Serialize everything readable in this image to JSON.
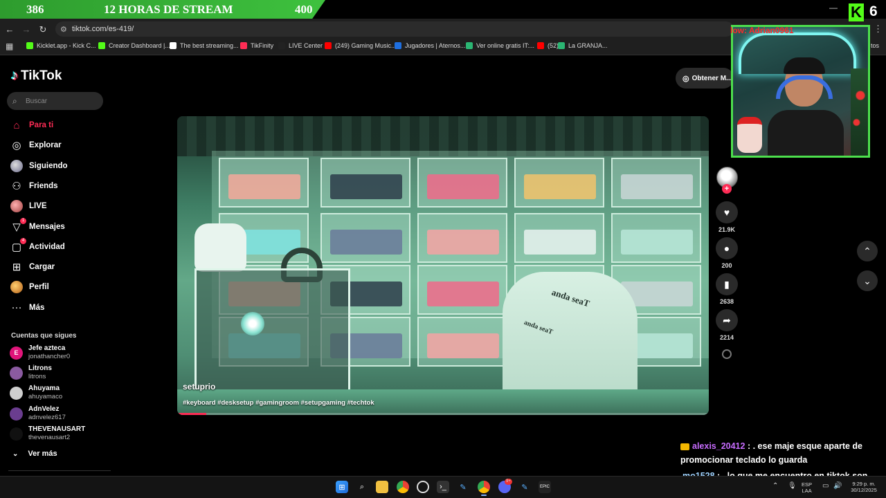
{
  "banner": {
    "left_number": "386",
    "title": "12 HORAS DE STREAM",
    "right_number": "400"
  },
  "browser": {
    "url": "tiktok.com/es-419/",
    "bookmarks": [
      {
        "label": "Kicklet.app - Kick C...",
        "color": "#53fc18"
      },
      {
        "label": "Creator Dashboard |...",
        "color": "#53fc18"
      },
      {
        "label": "The best streaming...",
        "color": "#ffffff"
      },
      {
        "label": "TikFinity",
        "color": "#ff2d55"
      },
      {
        "label": "LIVE Center",
        "color": "#222222"
      },
      {
        "label": "(249) Gaming Music...",
        "color": "#ff0000"
      },
      {
        "label": "Jugadores | Aternos...",
        "color": "#1e6fe0"
      },
      {
        "label": "Ver online gratis IT:...",
        "color": "#2bb673"
      },
      {
        "label": "(52)",
        "color": "#ff0000"
      },
      {
        "label": "La GRANJA...",
        "color": "#2bb673"
      }
    ],
    "bookmarks_overflow": "tos"
  },
  "tiktok": {
    "logo": "TikTok",
    "search_placeholder": "Buscar",
    "nav": [
      {
        "label": "Para ti",
        "icon": "home-icon",
        "active": true
      },
      {
        "label": "Explorar",
        "icon": "compass-icon"
      },
      {
        "label": "Siguiendo",
        "icon": "following-avatar-icon"
      },
      {
        "label": "Friends",
        "icon": "friends-icon"
      },
      {
        "label": "LIVE",
        "icon": "live-avatar-icon"
      },
      {
        "label": "Mensajes",
        "icon": "messages-icon",
        "badge": "1"
      },
      {
        "label": "Actividad",
        "icon": "activity-icon",
        "badge": "4"
      },
      {
        "label": "Cargar",
        "icon": "upload-icon"
      },
      {
        "label": "Perfil",
        "icon": "profile-avatar-icon"
      },
      {
        "label": "Más",
        "icon": "more-icon"
      }
    ],
    "following_title": "Cuentas que sigues",
    "following": [
      {
        "name": "Jefe azteca",
        "handle": "jonathancher0",
        "avatar_color": "#e0157a",
        "initial": "E"
      },
      {
        "name": "Litrons",
        "handle": "litrons",
        "avatar_color": "#8a5aa0",
        "initial": ""
      },
      {
        "name": "Ahuyama",
        "handle": "ahuyamaco",
        "avatar_color": "#cfcfcf",
        "initial": ""
      },
      {
        "name": "AdnVelez",
        "handle": "adnvelez617",
        "avatar_color": "#6a3d8f",
        "initial": ""
      },
      {
        "name": "THEVENAUSART",
        "handle": "thevenausart2",
        "avatar_color": "#111111",
        "initial": ""
      }
    ],
    "see_more": "Ver más",
    "get_app": "Obtener M...",
    "video": {
      "author": "setuprio",
      "hashtags": "#keyboard #desksetup #gamingroom #setupgaming #techtok",
      "progress": 0.055,
      "chair_brand": "anda seaT"
    },
    "actions": {
      "likes": "21.9K",
      "comments": "200",
      "saves": "2638",
      "shares": "2214"
    }
  },
  "stream_overlay": {
    "follow_text": "low: Adrian0961",
    "kick_letter": "K",
    "kick_number": "6",
    "chat": [
      {
        "user": "alexis_20412",
        "message": ": . ese maje esque aparte de promocionar teclado lo guarda",
        "badge": true
      },
      {
        "user": "mo1528",
        "message": ": . lo que me encuentro en tiktok son poemas",
        "badge": false
      }
    ]
  },
  "taskbar": {
    "lang": "ESP",
    "region": "LAA",
    "time": "9:29 p. m.",
    "date": "30/12/2025",
    "discord_badge": "9+"
  }
}
